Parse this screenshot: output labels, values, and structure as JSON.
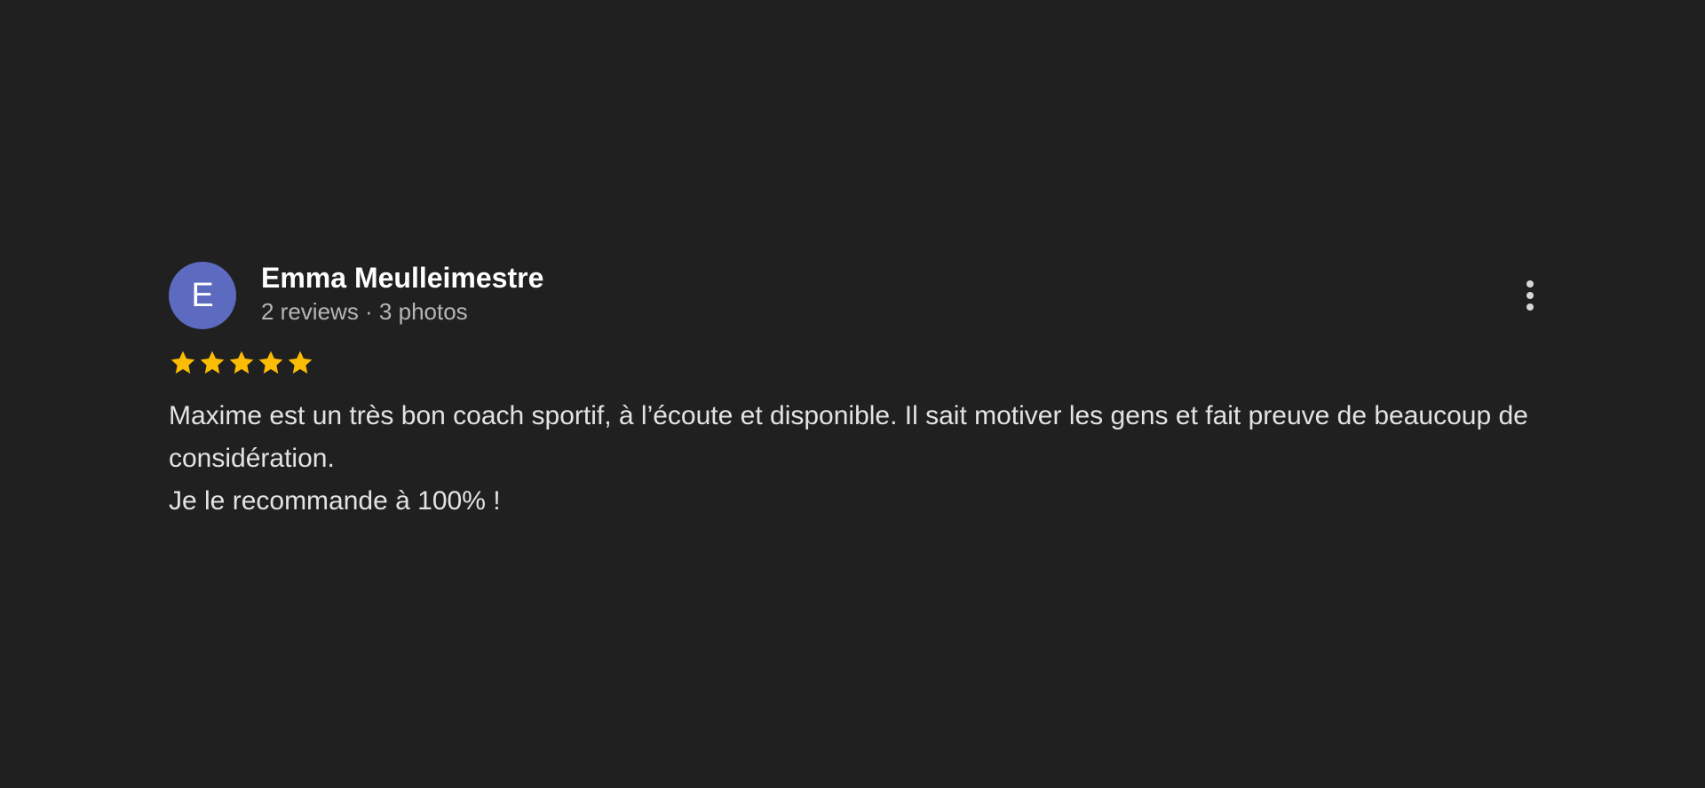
{
  "reviewer": {
    "initial": "E",
    "name": "Emma Meulleimestre",
    "meta": "2 reviews · 3 photos",
    "avatar_color": "#5c6bc0"
  },
  "rating": {
    "stars": 5,
    "max": 5,
    "star_color": "#fbbc04"
  },
  "review": {
    "line1": "Maxime est un très bon coach sportif, à l’écoute et disponible. Il sait motiver les gens et fait preuve de beaucoup de considération.",
    "line2": "Je le recommande à 100% !"
  },
  "menu": {
    "icon": "more-vertical-icon"
  }
}
